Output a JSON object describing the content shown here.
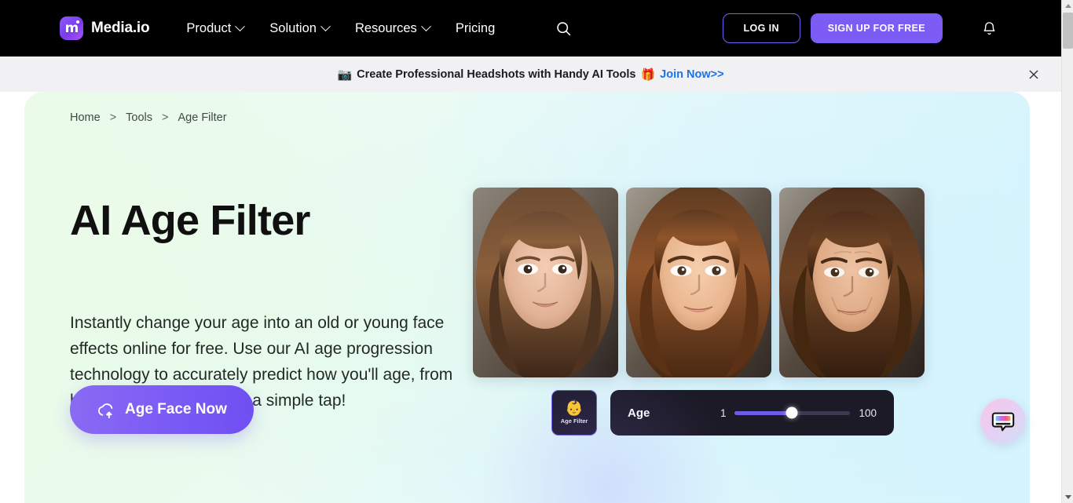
{
  "navbar": {
    "brand": {
      "glyph": "m",
      "name": "Media.io"
    },
    "links": [
      {
        "label": "Product",
        "has_caret": true
      },
      {
        "label": "Solution",
        "has_caret": true
      },
      {
        "label": "Resources",
        "has_caret": true
      },
      {
        "label": "Pricing",
        "has_caret": false
      }
    ],
    "search_icon": "search-icon",
    "login_label": "LOG IN",
    "signup_label": "SIGN UP FOR FREE",
    "bell_icon": "notification-bell-icon",
    "colors": {
      "background": "#000000",
      "accent": "#7c5cf5",
      "login_border": "#7c5cf0"
    }
  },
  "promo": {
    "left_emoji": "📷",
    "text": "Create Professional Headshots with Handy AI Tools",
    "right_emoji": "🎁",
    "link_label": "Join Now>>",
    "link_color": "#1a73e8",
    "close_icon": "close-icon",
    "background": "#f1f1f3"
  },
  "hero": {
    "breadcrumb": [
      {
        "label": "Home"
      },
      {
        "label": "Tools"
      },
      {
        "label": "Age Filter"
      }
    ],
    "breadcrumb_separator": ">",
    "title": "AI Age Filter",
    "description": "Instantly change your age into an old or young face effects online for free. Use our AI age progression technology to accurately predict how you'll age, from birth to old age, with just a simple tap!",
    "cta": {
      "label": "Age Face Now",
      "icon": "cloud-upload-icon",
      "color": "#7c5cf5"
    },
    "gallery": [
      {
        "alt": "child-portrait"
      },
      {
        "alt": "young-adult-portrait"
      },
      {
        "alt": "middle-aged-portrait"
      }
    ],
    "control": {
      "filter_tile": {
        "emoji": "👶",
        "label": "Age Filter"
      },
      "slider": {
        "label": "Age",
        "min": "1",
        "max": "100",
        "fill_percent": 50,
        "thumb_percent": 50,
        "fill_color": "#6c5ce7",
        "track_color": "#3b3850"
      },
      "panel_background": "#1b1a26"
    },
    "background_start": "#eafbe9",
    "background_end": "#d6f4fd"
  },
  "chat_widget": {
    "icon": "chat-bubble-icon"
  },
  "scrollbar": {
    "up_icon": "scroll-up-arrow-icon",
    "down_icon": "scroll-down-arrow-icon"
  }
}
